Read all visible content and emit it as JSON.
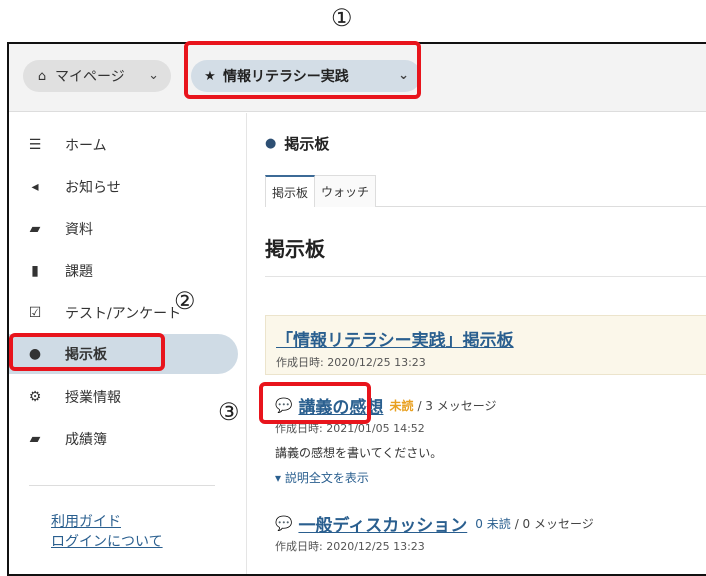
{
  "annotations": {
    "n1": "①",
    "n2": "②",
    "n3": "③"
  },
  "topbar": {
    "mypage": {
      "label": "マイページ",
      "icon": "home-icon"
    },
    "course": {
      "label": "情報リテラシー実践",
      "icon": "star-icon"
    }
  },
  "sidebar": {
    "items": [
      {
        "label": "ホーム",
        "icon": "list-icon"
      },
      {
        "label": "お知らせ",
        "icon": "megaphone-icon"
      },
      {
        "label": "資料",
        "icon": "folder-icon"
      },
      {
        "label": "課題",
        "icon": "file-icon"
      },
      {
        "label": "テスト/アンケート",
        "icon": "checkbox-icon"
      },
      {
        "label": "掲示板",
        "icon": "comments-icon",
        "active": true
      },
      {
        "label": "授業情報",
        "icon": "gear-icon"
      },
      {
        "label": "成績簿",
        "icon": "book-icon"
      }
    ],
    "links": [
      "利用ガイド",
      "ログインについて"
    ]
  },
  "main": {
    "header": "掲示板",
    "tabs": [
      "掲示板",
      "ウォッチ"
    ],
    "title": "掲示板",
    "board": {
      "title": "「情報リテラシー実践」掲示板",
      "created": "作成日時: 2020/12/25 13:23"
    },
    "threads": [
      {
        "title": "講義の感想",
        "unread": "未読",
        "messages": "/ 3 メッセージ",
        "created": "作成日時: 2021/01/05 14:52",
        "description": "講義の感想を書いてください。",
        "expand": "説明全文を表示"
      },
      {
        "title": "一般ディスカッション",
        "unread": "0 未読",
        "messages": "/ 0 メッセージ",
        "created": "作成日時: 2020/12/25 13:23"
      }
    ]
  },
  "colors": {
    "highlight": "#e8141c",
    "link": "#2a5f8f",
    "active_nav": "#cfdbe5",
    "unread": "#e8a020"
  }
}
